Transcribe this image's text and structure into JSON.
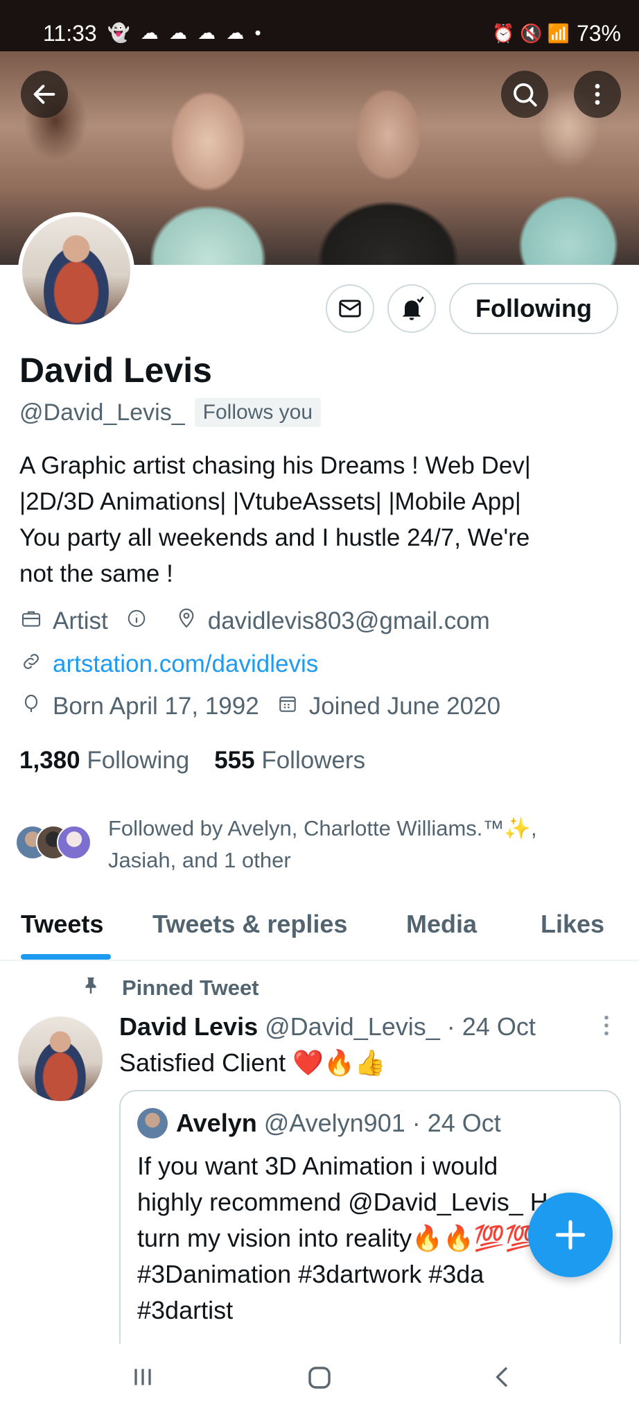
{
  "status_bar": {
    "time": "11:33",
    "notification_icons": "👻 ☁ ☁ ☁ ☁ •",
    "right_icons": "⏰ 🔇 📶",
    "battery": "73%"
  },
  "profile": {
    "name": "David Levis",
    "handle": "@David_Levis_",
    "follows_you": "Follows you",
    "bio": "A Graphic artist chasing his Dreams !   Web Dev|\n|2D/3D Animations| |VtubeAssets| |Mobile App|\nYou party all weekends and I hustle 24/7, We're\nnot the same !",
    "category": "Artist",
    "location": "davidlevis803@gmail.com",
    "website": "artstation.com/davidlevis",
    "birthday": "Born April 17, 1992",
    "joined": "Joined June 2020",
    "following_count": "1,380",
    "following_label": "Following",
    "followers_count": "555",
    "followers_label": "Followers",
    "followed_by": "Followed by Avelyn, Charlotte Williams.™✨, Jasiah, and 1 other"
  },
  "actions": {
    "following_button": "Following"
  },
  "tabs": [
    {
      "label": "Tweets"
    },
    {
      "label": "Tweets & replies"
    },
    {
      "label": "Media"
    },
    {
      "label": "Likes"
    }
  ],
  "tweet": {
    "pinned_label": "Pinned Tweet",
    "author": "David Levis",
    "handle": "@David_Levis_",
    "date": "· 24 Oct",
    "text": "Satisfied Client ❤️🔥👍",
    "quote": {
      "author": "Avelyn",
      "handle": "@Avelyn901",
      "date": "· 24 Oct",
      "text": "If you want 3D Animation i would\nhighly recommend @David_Levis_  He\nturn my vision into reality🔥🔥💯💯\n#3Danimation #3dartwork #3da\n#3dartist"
    }
  },
  "icons": {
    "back": "back-arrow-icon",
    "search": "search-icon",
    "more": "more-vertical-icon",
    "message": "mail-icon",
    "notifications": "bell-icon",
    "compose": "plus-icon"
  },
  "colors": {
    "accent": "#1d9bf0",
    "text_primary": "#0f1419",
    "text_secondary": "#536471"
  }
}
